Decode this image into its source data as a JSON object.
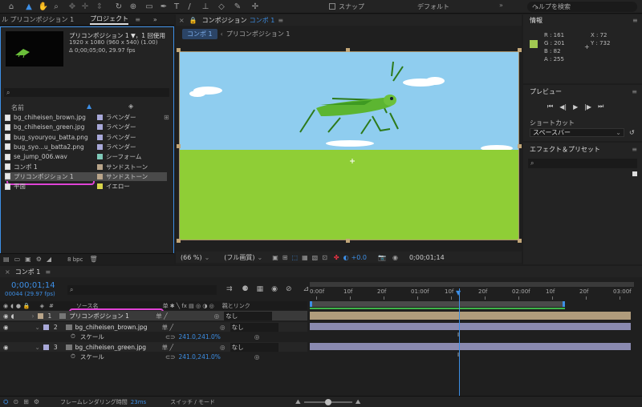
{
  "top_toolbar": {
    "snap_label": "スナップ",
    "workspace": "デフォルト",
    "help_search_placeholder": "ヘルプを検索"
  },
  "project_panel": {
    "tab_left": "ル プリコンポジション 1",
    "tab_active": "プロジェクト",
    "preview_title": "プリコンポジション 1 ▼，1 回使用",
    "preview_size": "1920 x 1080 (960 x 540) (1.00)",
    "preview_duration": "Δ 0;00;05;00, 29.97 fps",
    "col_name": "名前",
    "bpc": "8 bpc",
    "items": [
      {
        "name": "bg_chiheisen_brown.jpg",
        "label": "ラベンダー",
        "color": "#a8a8d8"
      },
      {
        "name": "bg_chiheisen_green.jpg",
        "label": "ラベンダー",
        "color": "#a8a8d8"
      },
      {
        "name": "bug_syouryou_batta.png",
        "label": "ラベンダー",
        "color": "#a8a8d8"
      },
      {
        "name": "bug_syo...u_batta2.png",
        "label": "ラベンダー",
        "color": "#a8a8d8"
      },
      {
        "name": "se_jump_006.wav",
        "label": "シーフォーム",
        "color": "#7fc9b8"
      },
      {
        "name": "コンポ 1",
        "label": "サンドストーン",
        "color": "#b9a58a"
      },
      {
        "name": "プリコンポジション 1",
        "label": "サンドストーン",
        "color": "#b9a58a"
      },
      {
        "name": "平面",
        "label": "イエロー",
        "color": "#d8d44a"
      }
    ]
  },
  "composition_panel": {
    "tab_title": "コンポジション",
    "tab_comp": "コンポ 1",
    "crumb_active": "コンポ 1",
    "crumb_next": "プリコンポジション 1",
    "zoom": "(66 %)",
    "quality": "(フル画質)",
    "exposure": "+0.0",
    "timecode": "0;00;01;14"
  },
  "info_panel": {
    "title": "情報",
    "r": "R : 161",
    "g": "G : 201",
    "b": "B : 82",
    "a": "A : 255",
    "x": "X : 72",
    "y": "Y : 732",
    "swatch": "#a1c952"
  },
  "preview_panel": {
    "title": "プレビュー",
    "shortcut_label": "ショートカット",
    "shortcut_value": "スペースバー"
  },
  "effects_panel": {
    "title": "エフェクト＆プリセット"
  },
  "timeline": {
    "tab": "コンポ 1",
    "timecode": "0;00;01;14",
    "frames": "00044 (29.97 fps)",
    "col_source": "ソース名",
    "col_parent": "親とリンク",
    "ruler": [
      "0:00f",
      "10f",
      "20f",
      "01:00f",
      "10f",
      "20f",
      "02:00f",
      "10f",
      "20f",
      "03:00f"
    ],
    "layers": [
      {
        "num": "1",
        "name": "プリコンポジション 1",
        "parent": "なし",
        "color": "#b9a58a"
      },
      {
        "num": "2",
        "name": "bg_chiheisen_brown.jpg",
        "parent": "なし",
        "color": "#a8a8d8",
        "prop": "スケール",
        "value": "241.0,241.0%"
      },
      {
        "num": "3",
        "name": "bg_chiheisen_green.jpg",
        "parent": "なし",
        "color": "#a8a8d8",
        "prop": "スケール",
        "value": "241.0,241.0%"
      }
    ],
    "render_label": "フレームレンダリング時間",
    "render_value": "23ms",
    "switch_mode": "スイッチ / モード"
  }
}
